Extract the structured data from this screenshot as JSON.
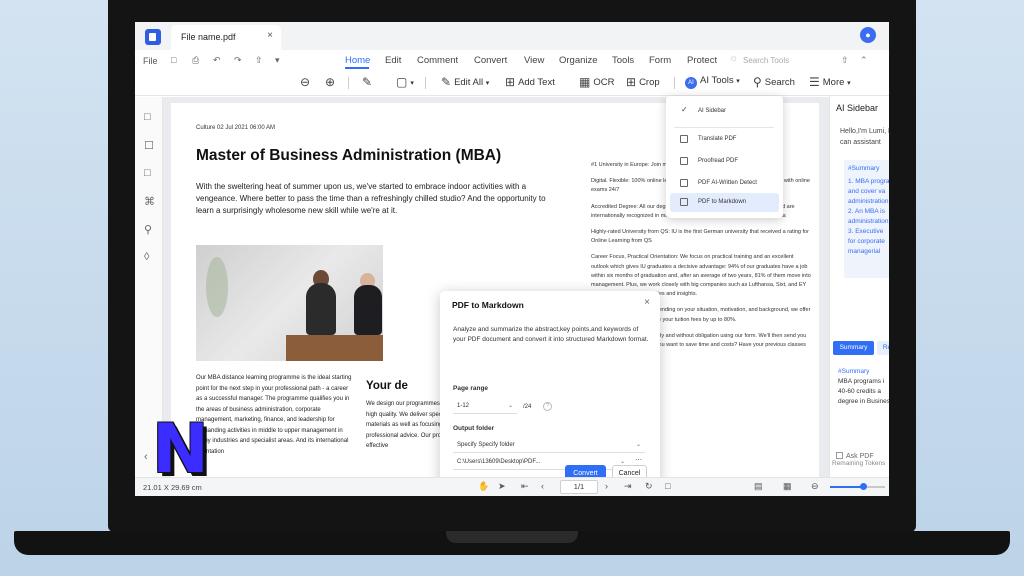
{
  "colors": {
    "accent": "#2f6ef5",
    "brand": "#3b2cff",
    "laptop": "#141414"
  },
  "tab": {
    "title": "File name.pdf",
    "close": "×"
  },
  "menu": {
    "file": "File",
    "items": [
      "Home",
      "Edit",
      "Comment",
      "Convert",
      "View",
      "Organize",
      "Tools",
      "Form",
      "Protect"
    ],
    "active": "Home",
    "search_placeholder": "Search Tools"
  },
  "toolbar": {
    "edit_all": "Edit All",
    "add_text": "Add Text",
    "ocr": "OCR",
    "crop": "Crop",
    "ai_tools": "AI Tools",
    "search": "Search",
    "more": "More"
  },
  "ai_menu": {
    "items": [
      "AI Sidebar",
      "Translate PDF",
      "Proofread PDF",
      "PDF AI-Written Detect",
      "PDF to Markdown"
    ],
    "highlighted": "PDF to Markdown",
    "checked": "AI Sidebar"
  },
  "document": {
    "meta": "Culture  02 Jul 2021 06:00 AM",
    "title": "Master of Business Administration (MBA)",
    "intro": "With the sweltering heat of summer upon us, we've started to embrace indoor activities with a vengeance. Where better to pass the time than a refreshingly chilled studio? And the opportunity to learn a surprisingly wholesome new skill while we're at it.",
    "col1": "Our MBA distance learning programme is the ideal starting point for the next step in your professional path - a career as a successful manager. The programme qualifies you in the areas of business administration, corporate management, marketing, finance, and leadership for demanding activities in middle to upper management in many industries and specialist areas. And its international orientation",
    "heading2": "Your de",
    "col2": "We design our programmes to be flexible and innovative, and of a high quality. We deliver specialist expertise and innovative learning materials as well as focusing on excellent student services and professional advice. Our programmes are characterised by the effective",
    "right_paragraphs": [
      "#1 University in Europe: Join more than 85,000 students",
      "Digital. Flexible: 100% online learning materials and a great online campus are with online exams 24/7",
      "Accredited Degree: All our degrees benefit from German state accreditation and are internationally recognized in major jurisdictions such as the EU, US and Canada",
      "Highly-rated University from QS: IU is the first German university that received a rating for Online Learning from QS",
      "Career Focus, Practical Orientation: We focus on practical training and an excellent outlook which gives IU graduates a decisive advantage: 94% of our graduates have a job within six months of graduation and, after an average of two years, 81% of them move into management. Plus, we work closely with big companies such as Lufthansa, Sixt, and EY to give you great opportunities and insights.",
      "Scholarships available: Depending on your situation, motivation, and background, we offer scholarships that can reduce your tuition fees by up to 80%.",
      "Secure your place at IU easily and without obligation using our form. We'll then send you your study agreement! Do you want to save time and costs? Have your previous classes recognised!"
    ]
  },
  "dialog": {
    "title": "PDF to Markdown",
    "description": "Analyze and summarize the abstract,key points,and keywords of your PDF document and convert it into structured Markdown format.",
    "page_range_label": "Page range",
    "page_range_value": "1-12",
    "page_range_total": "/24",
    "output_folder_label": "Output folder",
    "folder_option": "Specify Specify folder",
    "folder_path": "C:\\Users\\13609\\Desktop\\PDF...",
    "convert": "Convert",
    "cancel": "Cancel"
  },
  "sidebar": {
    "title": "AI Sidebar",
    "greeting": "Hello,I'm Lumi, I can assistant",
    "card_heading": "#Summary",
    "card_lines": [
      "1. MBA program",
      "and cover va",
      "administration",
      "2. An MBA is",
      "administration",
      "3. Executive",
      "for corporate",
      "managerial"
    ],
    "tab_active": "Summary",
    "tab_other": "Re",
    "summary_heading": "#Summary",
    "summary_lines": [
      "MBA programs i",
      "40-60 credits a",
      "degree in Business"
    ],
    "ask": "Ask PDF",
    "remaining": "Remaining Tokens"
  },
  "statusbar": {
    "page_size": "21.01 X 29.69 cm",
    "page_indicator": "1/1",
    "zoom_fraction": 0.6
  },
  "overlay_logo": "N"
}
